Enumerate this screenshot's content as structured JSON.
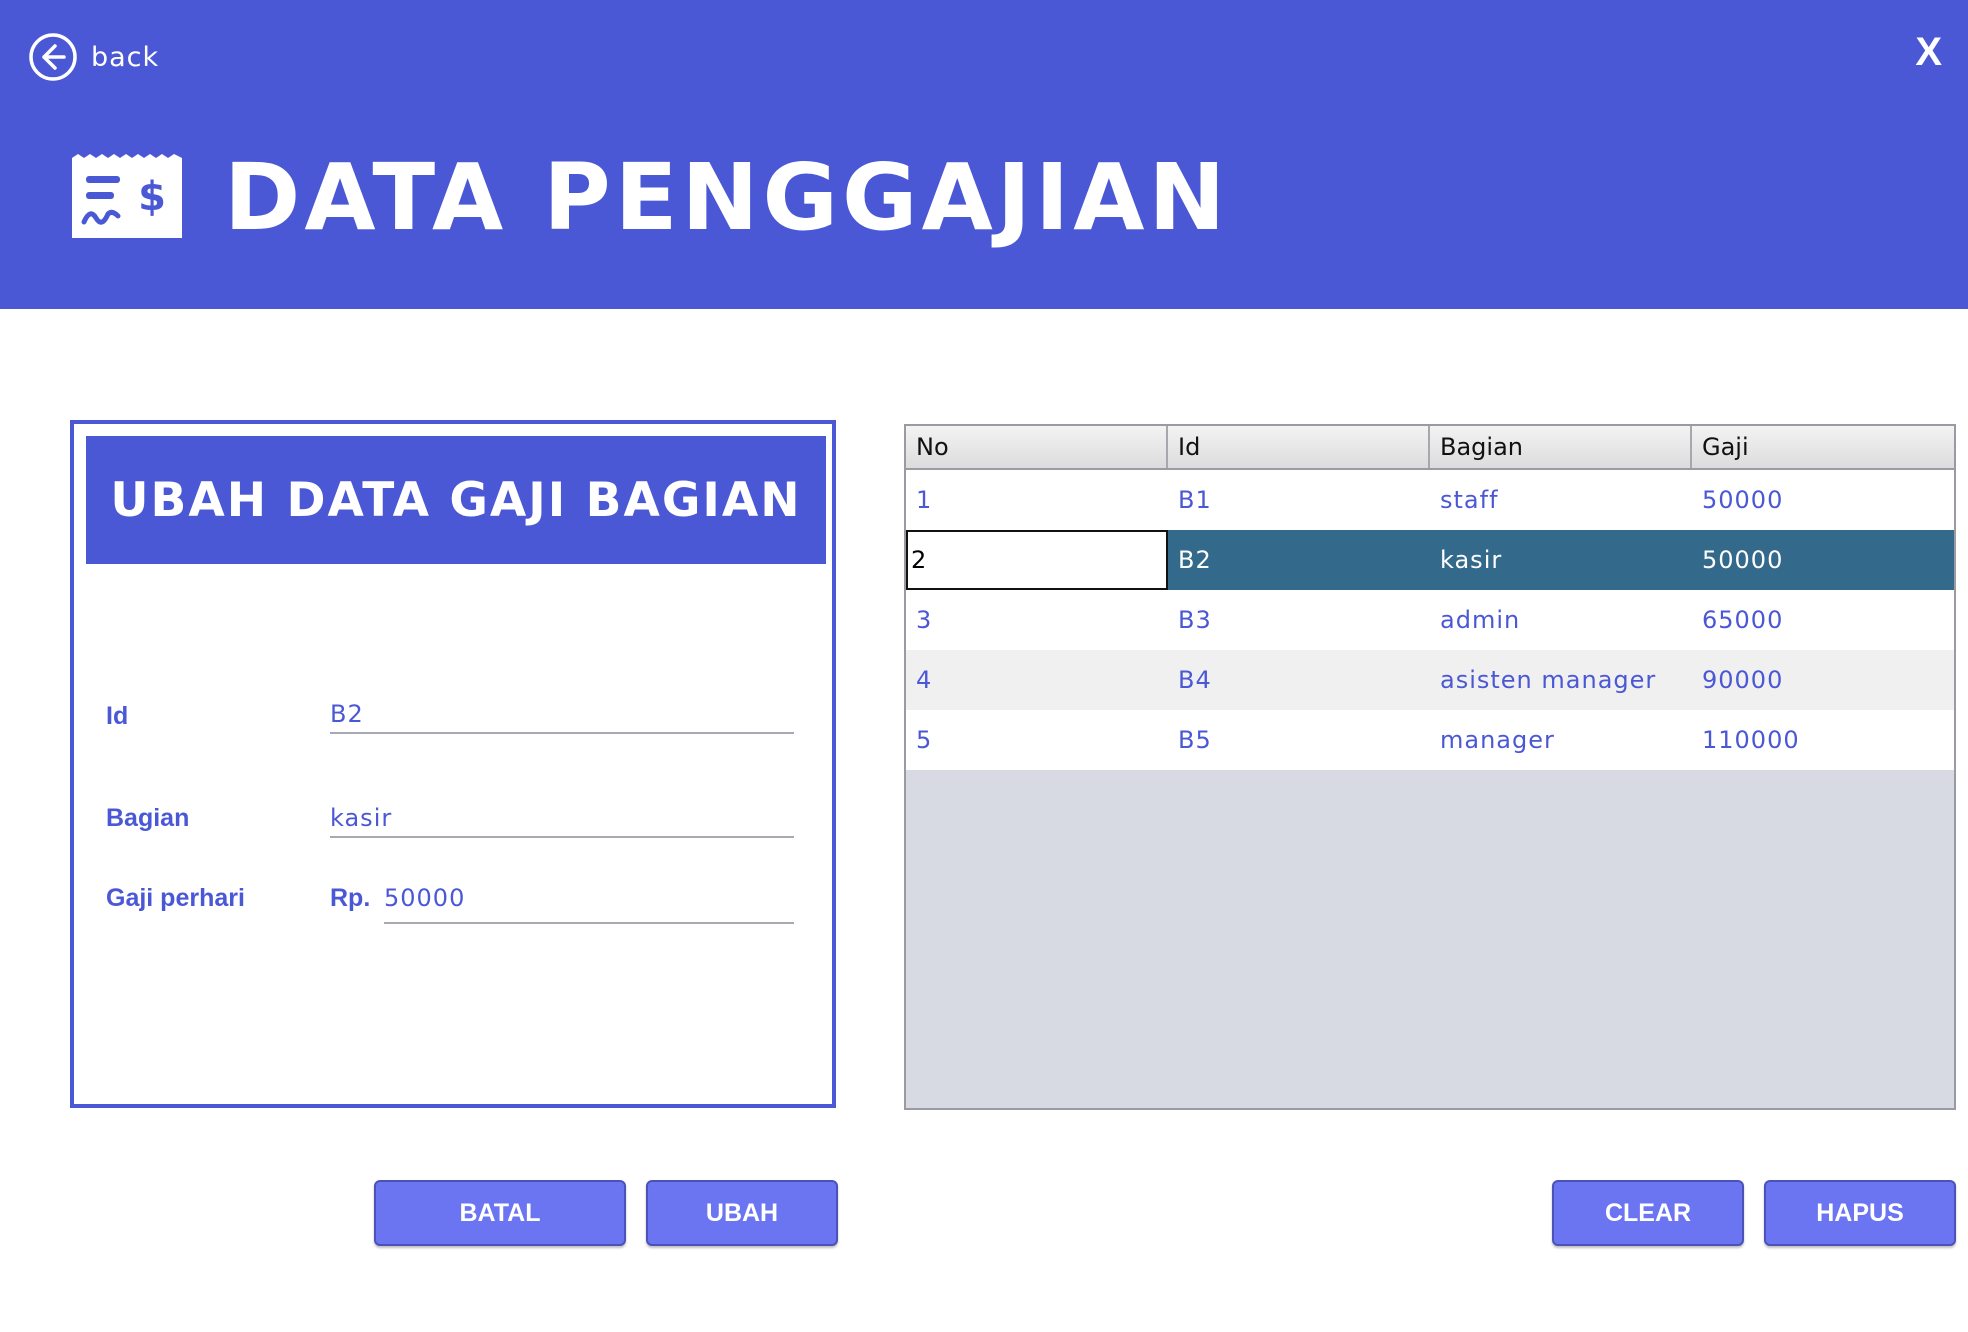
{
  "header": {
    "back_label": "back",
    "close_label": "X",
    "title": "DATA PENGGAJIAN",
    "background": "#4B58D6"
  },
  "form": {
    "banner": "UBAH DATA GAJI BAGIAN",
    "id_label": "Id",
    "id_value": "B2",
    "bagian_label": "Bagian",
    "bagian_value": "kasir",
    "gaji_label": "Gaji perhari",
    "currency_prefix": "Rp.",
    "gaji_value": "50000",
    "batal_label": "BATAL",
    "ubah_label": "UBAH"
  },
  "table": {
    "headers": [
      "No",
      "Id",
      "Bagian",
      "Gaji"
    ],
    "rows": [
      [
        "1",
        "B1",
        "staff",
        "50000"
      ],
      [
        "2",
        "B2",
        "kasir",
        "50000"
      ],
      [
        "3",
        "B3",
        "admin",
        "65000"
      ],
      [
        "4",
        "B4",
        "asisten manager",
        "90000"
      ],
      [
        "5",
        "B5",
        "manager",
        "110000"
      ]
    ],
    "selected_row": 2,
    "clear_label": "CLEAR",
    "hapus_label": "HAPUS"
  },
  "icons": {
    "back": "arrow-left-circle-icon",
    "close": "close-icon",
    "title": "payroll-receipt-icon"
  },
  "colors": {
    "primary": "#4B58D6",
    "button": "#6B75F2",
    "selected_row": "#336A8B"
  }
}
